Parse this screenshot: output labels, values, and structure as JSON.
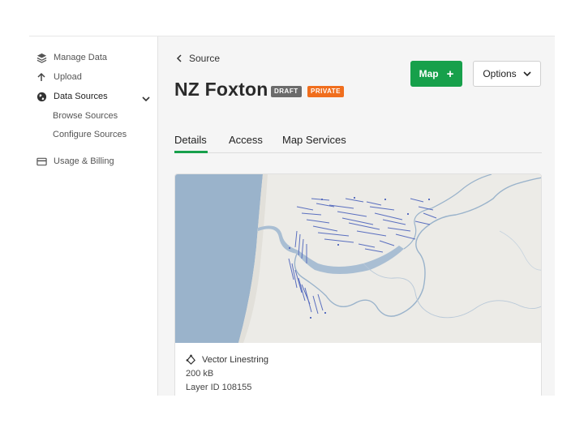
{
  "sidebar": {
    "items": [
      {
        "label": "Manage Data",
        "icon": "layers-icon"
      },
      {
        "label": "Upload",
        "icon": "upload-arrow-icon"
      },
      {
        "label": "Data Sources",
        "icon": "globe-icon",
        "expanded": true
      },
      {
        "label": "Usage & Billing",
        "icon": "credit-card-icon"
      }
    ],
    "subitems": [
      {
        "label": "Browse Sources"
      },
      {
        "label": "Configure Sources"
      }
    ]
  },
  "breadcrumb": {
    "label": "Source"
  },
  "page": {
    "title": "NZ Foxton",
    "badges": {
      "draft": "DRAFT",
      "private": "PRIVATE"
    }
  },
  "actions": {
    "map_label": "Map",
    "map_icon": "+",
    "options_label": "Options"
  },
  "tabs": [
    {
      "label": "Details",
      "active": true
    },
    {
      "label": "Access"
    },
    {
      "label": "Map Services"
    }
  ],
  "card": {
    "type_label": "Vector Linestring",
    "type_icon": "linestring-icon",
    "size": "200 kB",
    "layer_id": "Layer ID 108155"
  },
  "colors": {
    "accent_green": "#17a04b",
    "draft_badge": "#6b6b6b",
    "private_badge": "#f06e1d",
    "water": "#9ab3cb",
    "land": "#ecebe7",
    "data_lines": "#5a6fbf"
  }
}
